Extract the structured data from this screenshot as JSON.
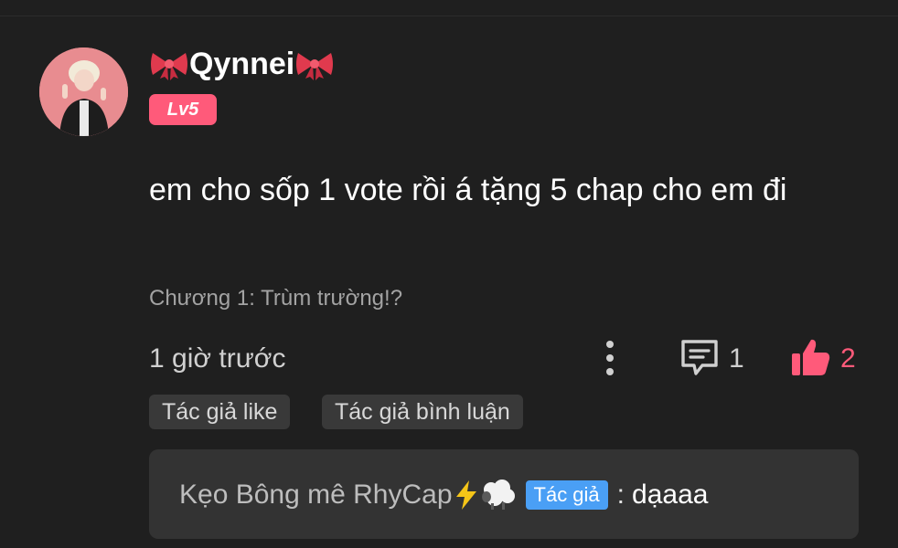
{
  "comment": {
    "username": "Qynnei",
    "level": "Lv5",
    "text": "em cho sốp 1 vote rồi á tặng 5 chap cho em đi",
    "chapter": "Chương 1: Trùm trường!?",
    "timestamp": "1 giờ trước",
    "reply_count": "1",
    "like_count": "2"
  },
  "tags": {
    "author_like": "Tác giả like",
    "author_reply": "Tác giả bình luận"
  },
  "reply": {
    "author": "Kẹo Bông mê RhyCap",
    "badge": "Tác giả",
    "separator": ":",
    "text": "dạaaa"
  },
  "colors": {
    "background": "#1f1f1f",
    "accent_pink": "#ff5a7a",
    "author_badge": "#4a9ff5",
    "tag_bg": "#393939",
    "reply_bg": "#333333"
  },
  "icons": {
    "more": "more-vertical-icon",
    "reply": "comment-icon",
    "like": "thumbs-up-icon",
    "bow": "ribbon-bow-icon",
    "lightning": "lightning-icon",
    "sheep": "sheep-icon"
  }
}
